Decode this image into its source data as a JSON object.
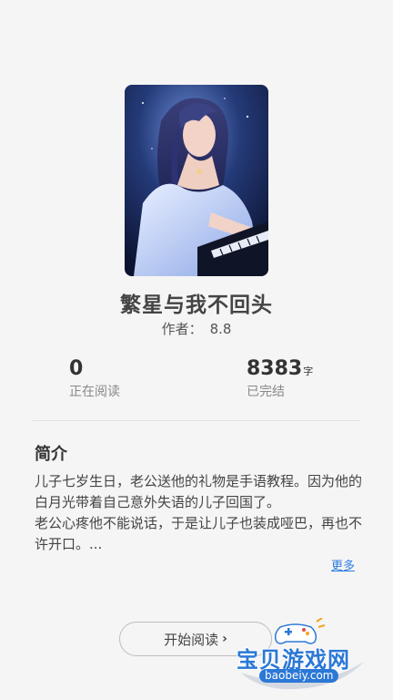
{
  "book": {
    "title": "繁星与我不回头",
    "author_label": "作者：",
    "author_value": "8.8"
  },
  "stats": {
    "reading": {
      "value": "0",
      "label": "正在阅读"
    },
    "words": {
      "value": "8383",
      "unit": "字",
      "label": "已完结"
    }
  },
  "intro": {
    "heading": "简介",
    "paragraphs": [
      "儿子七岁生日，老公送他的礼物是手语教程。因为他的白月光带着自己意外失语的儿子回国了。",
      "老公心疼他不能说话，于是让儿子也装成哑巴，再也不许开口。..."
    ],
    "more_label": "更多"
  },
  "actions": {
    "start_label": "开始阅读",
    "chevron": "›"
  },
  "watermark": {
    "name": "宝贝游戏网",
    "url": "baobeiy.com",
    "icon": "gamepad-icon"
  },
  "colors": {
    "accent": "#2f7de1",
    "background": "#f5f5f5"
  }
}
